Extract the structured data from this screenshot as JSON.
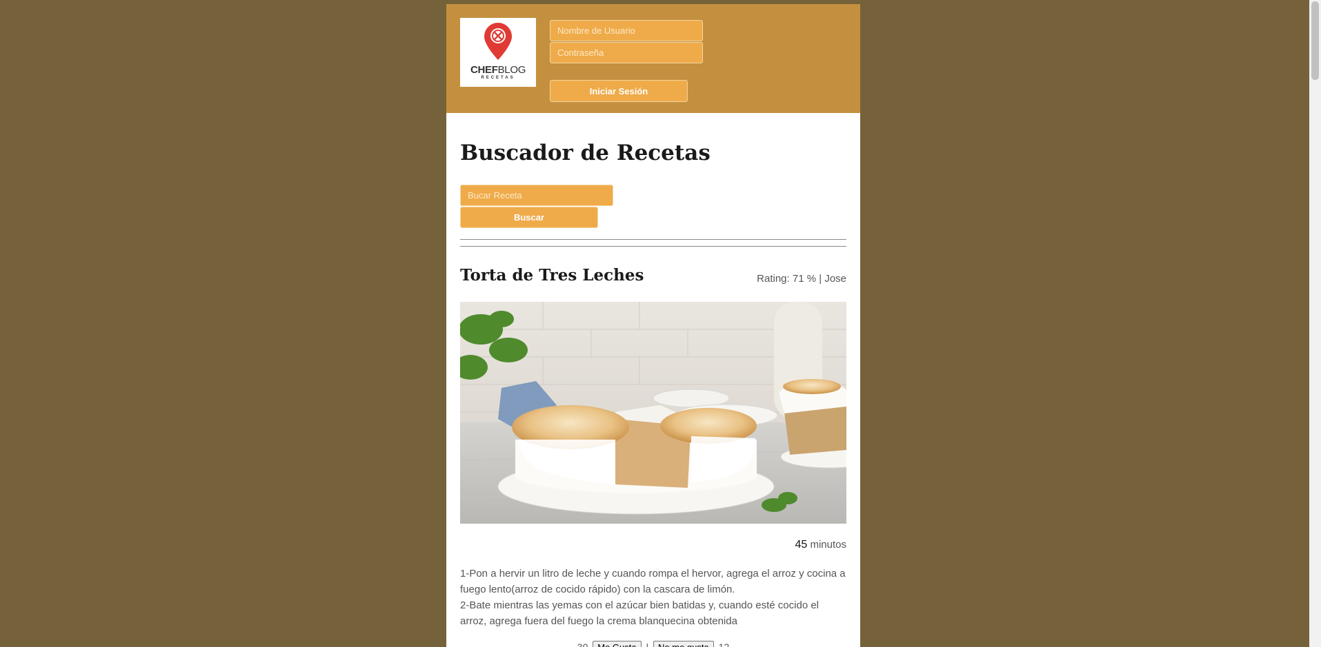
{
  "header": {
    "logo": {
      "brand_bold": "CHEF",
      "brand_light": "BLOG",
      "tagline": "RECETAS",
      "pin_color": "#e03a35"
    },
    "login": {
      "username_placeholder": "Nombre de Usuario",
      "password_placeholder": "Contraseña",
      "submit_label": "Iniciar Sesión"
    }
  },
  "main": {
    "title": "Buscador de Recetas",
    "search": {
      "placeholder": "Bucar Receta",
      "button_label": "Buscar"
    }
  },
  "recipe": {
    "title": "Torta de Tres Leches",
    "rating_label": "Rating:",
    "rating_value": "71 %",
    "separator": "|",
    "author": "Jose",
    "image_icon": "tres-leches-cake-photo",
    "time_value": "45",
    "time_unit": "minutos",
    "steps": [
      "1-Pon a hervir un litro de leche y cuando rompa el hervor, agrega el arroz y cocina a fuego lento(arroz de cocido rápido) con la cascara de limón.",
      "2-Bate mientras las yemas con el azúcar bien batidas y, cuando esté cocido el arroz, agrega fuera del fuego la crema blanquecina obtenida"
    ],
    "votes": {
      "likes": "30",
      "like_label": "Me Gusta",
      "separator": "|",
      "dislike_label": "No me gusta",
      "dislikes": "12"
    }
  },
  "colors": {
    "page_background": "#76623a",
    "header_background": "#c4903f",
    "accent": "#efab4a"
  }
}
